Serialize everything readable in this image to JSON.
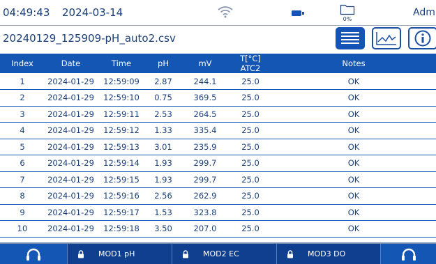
{
  "status": {
    "time": "04:49:43",
    "date": "2024-03-14",
    "storage_percent": "0%",
    "user": "Admin"
  },
  "file": {
    "name": "20240129_125909-pH_auto2.csv"
  },
  "table": {
    "headers": [
      "Index",
      "Date",
      "Time",
      "pH",
      "mV",
      "T[°C] ATC2",
      "Notes"
    ],
    "rows": [
      [
        "1",
        "2024-01-29",
        "12:59:09",
        "2.87",
        "244.1",
        "25.0",
        "OK"
      ],
      [
        "2",
        "2024-01-29",
        "12:59:10",
        "0.75",
        "369.5",
        "25.0",
        "OK"
      ],
      [
        "3",
        "2024-01-29",
        "12:59:11",
        "2.53",
        "264.5",
        "25.0",
        "OK"
      ],
      [
        "4",
        "2024-01-29",
        "12:59:12",
        "1.33",
        "335.4",
        "25.0",
        "OK"
      ],
      [
        "5",
        "2024-01-29",
        "12:59:13",
        "3.01",
        "235.9",
        "25.0",
        "OK"
      ],
      [
        "6",
        "2024-01-29",
        "12:59:14",
        "1.93",
        "299.7",
        "25.0",
        "OK"
      ],
      [
        "7",
        "2024-01-29",
        "12:59:15",
        "1.93",
        "299.7",
        "25.0",
        "OK"
      ],
      [
        "8",
        "2024-01-29",
        "12:59:16",
        "2.56",
        "262.9",
        "25.0",
        "OK"
      ],
      [
        "9",
        "2024-01-29",
        "12:59:17",
        "1.53",
        "323.8",
        "25.0",
        "OK"
      ],
      [
        "10",
        "2024-01-29",
        "12:59:18",
        "3.50",
        "207.0",
        "25.0",
        "OK"
      ]
    ]
  },
  "modules": [
    {
      "label": "MOD1 pH"
    },
    {
      "label": "MOD2 EC"
    },
    {
      "label": "MOD3 DO"
    }
  ],
  "colors": {
    "primary": "#1456b3",
    "dark": "#0f3f8e",
    "text": "#1a3f7a"
  }
}
